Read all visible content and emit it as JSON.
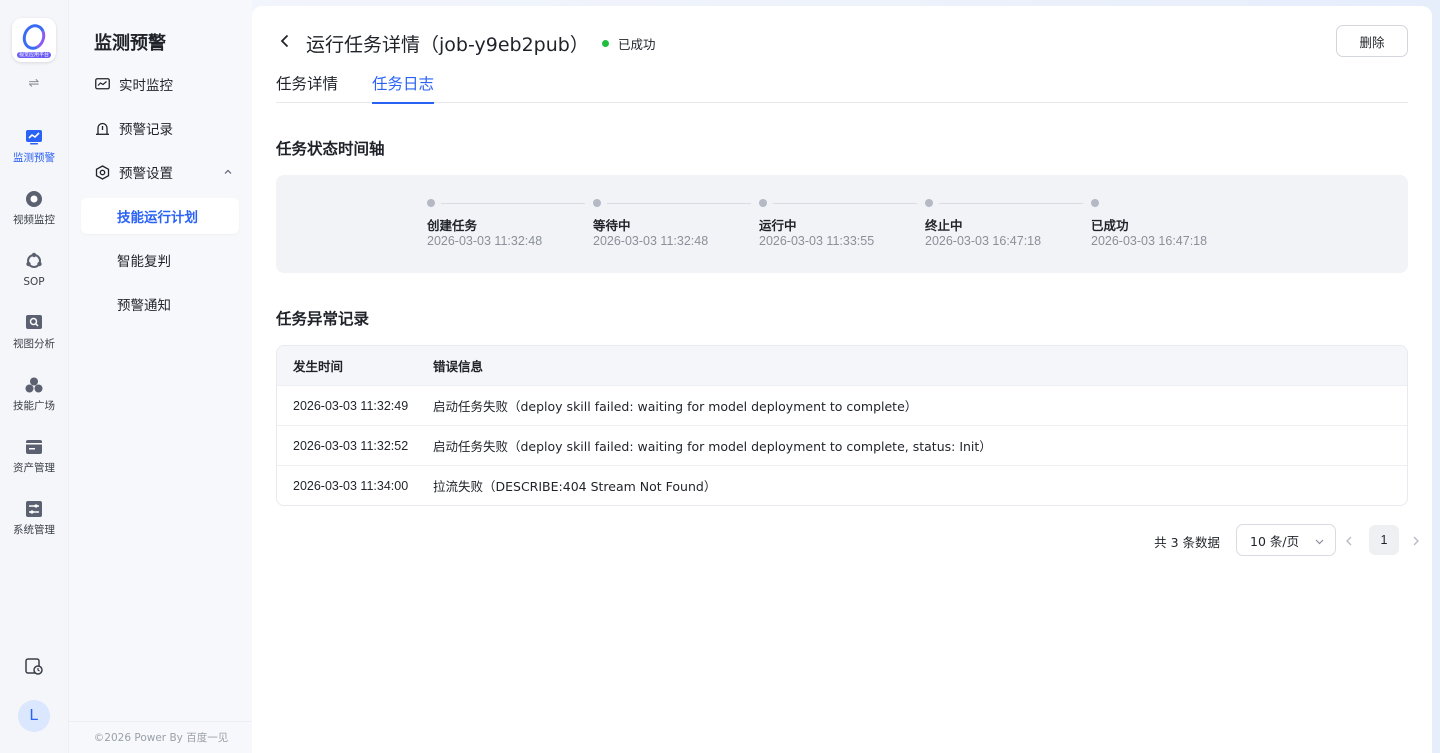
{
  "rail": {
    "logo_tag": "视觉应用平台",
    "toggle": "⇌",
    "items": [
      {
        "label": "监测预警",
        "icon": "monitor-chart-icon"
      },
      {
        "label": "视频监控",
        "icon": "camera-icon"
      },
      {
        "label": "SOP",
        "icon": "sop-icon"
      },
      {
        "label": "视图分析",
        "icon": "view-analysis-icon"
      },
      {
        "label": "技能广场",
        "icon": "skills-icon"
      },
      {
        "label": "资产管理",
        "icon": "assets-icon"
      },
      {
        "label": "系统管理",
        "icon": "system-icon"
      }
    ],
    "avatar": "L"
  },
  "menu": {
    "title": "监测预警",
    "items": [
      {
        "label": "实时监控"
      },
      {
        "label": "预警记录"
      },
      {
        "label": "预警设置"
      }
    ],
    "sub_items": [
      {
        "label": "技能运行计划"
      },
      {
        "label": "智能复判"
      },
      {
        "label": "预警通知"
      }
    ],
    "footer": "©2026 Power By 百度一见"
  },
  "header": {
    "title": "运行任务详情（job-y9eb2pub）",
    "status": "已成功",
    "delete_label": "删除"
  },
  "tabs": [
    {
      "label": "任务详情"
    },
    {
      "label": "任务日志"
    }
  ],
  "timeline": {
    "title": "任务状态时间轴",
    "steps": [
      {
        "name": "创建任务",
        "time": "2026-03-03 11:32:48"
      },
      {
        "name": "等待中",
        "time": "2026-03-03 11:32:48"
      },
      {
        "name": "运行中",
        "time": "2026-03-03 11:33:55"
      },
      {
        "name": "终止中",
        "time": "2026-03-03 16:47:18"
      },
      {
        "name": "已成功",
        "time": "2026-03-03 16:47:18"
      }
    ]
  },
  "errors": {
    "title": "任务异常记录",
    "columns": [
      "发生时间",
      "错误信息"
    ],
    "rows": [
      {
        "time": "2026-03-03 11:32:49",
        "message": "启动任务失败（deploy skill failed: waiting for model deployment to complete）"
      },
      {
        "time": "2026-03-03 11:32:52",
        "message": "启动任务失败（deploy skill failed: waiting for model deployment to complete, status: Init）"
      },
      {
        "time": "2026-03-03 11:34:00",
        "message": "拉流失败（DESCRIBE:404 Stream Not Found）"
      }
    ]
  },
  "pagination": {
    "total": "共 3 条数据",
    "page_size": "10 条/页",
    "current_page": "1"
  },
  "colors": {
    "accent": "#2a62f6",
    "success": "#1fbd3c"
  }
}
